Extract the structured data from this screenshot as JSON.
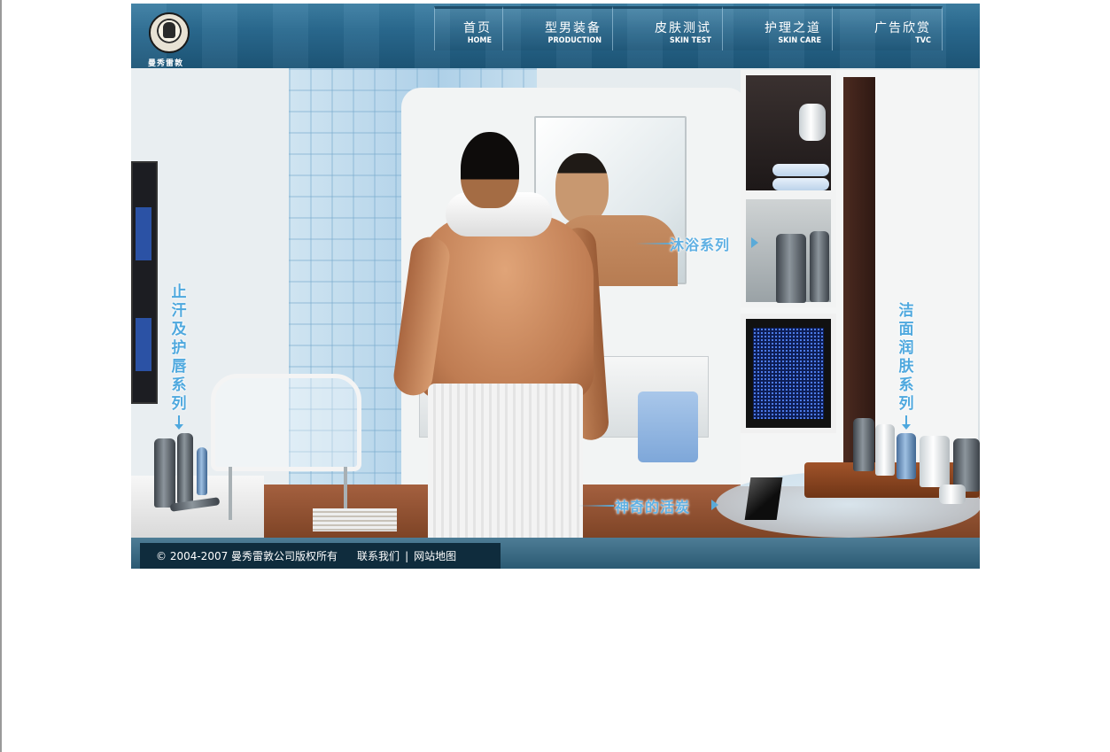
{
  "brand": {
    "name": "曼秀雷敦",
    "logo_icon": "mentholatum-seal-icon"
  },
  "nav": {
    "items": [
      {
        "zh": "首页",
        "en": "HOME"
      },
      {
        "zh": "型男装备",
        "en": "PRODUCTION"
      },
      {
        "zh": "皮肤测试",
        "en": "SKIN TEST"
      },
      {
        "zh": "护理之道",
        "en": "SKIN CARE"
      },
      {
        "zh": "广告欣赏",
        "en": "TVC"
      }
    ]
  },
  "scene": {
    "callouts": {
      "antiperspirant": "止汗及护唇系列",
      "cleansing": "洁面润肤系列",
      "bath": "沐浴系列",
      "charcoal": "神奇的活炭"
    }
  },
  "footer": {
    "copyright": "© 2004-2007 曼秀雷敦公司版权所有",
    "contact": "联系我们",
    "divider": "|",
    "sitemap": "网站地图"
  },
  "colors": {
    "header": "#2a6a90",
    "footer_dark": "#0f2c3d",
    "callout_blue": "#4ea8de"
  }
}
